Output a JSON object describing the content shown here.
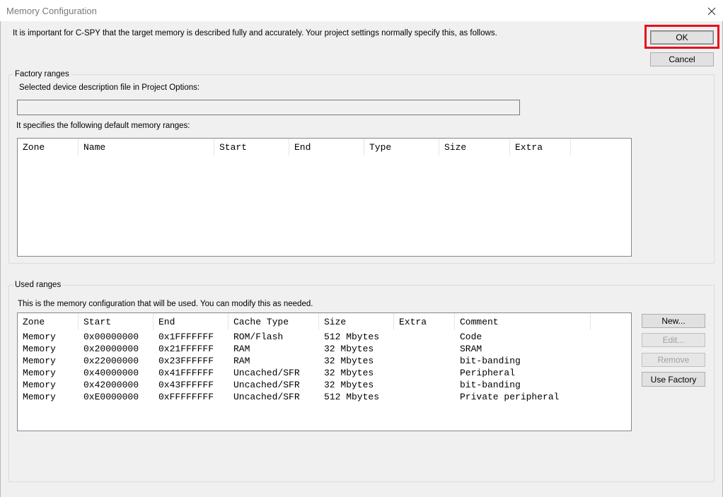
{
  "window": {
    "title": "Memory Configuration",
    "close_icon": "close-icon"
  },
  "intro_text": "It is important for C-SPY that the target memory is described fully and accurately. Your project settings normally specify this, as follows.",
  "buttons": {
    "ok": "OK",
    "cancel": "Cancel",
    "new": "New...",
    "edit": "Edit...",
    "remove": "Remove",
    "use_factory": "Use Factory"
  },
  "highlight_color": "#e8101c",
  "factory": {
    "group_label": "Factory ranges",
    "device_label": "Selected device description file in Project Options:",
    "device_value": "",
    "ranges_label": "It specifies the following default memory ranges:",
    "columns": [
      "Zone",
      "Name",
      "Start",
      "End",
      "Type",
      "Size",
      "Extra"
    ],
    "rows": []
  },
  "used": {
    "group_label": "Used ranges",
    "description": "This is the memory configuration that will be used. You can modify this as needed.",
    "columns": [
      "Zone",
      "Start",
      "End",
      "Cache Type",
      "Size",
      "Extra",
      "Comment"
    ],
    "rows": [
      [
        "Memory",
        "0x00000000",
        "0x1FFFFFFF",
        "ROM/Flash",
        "512 Mbytes",
        "",
        "Code"
      ],
      [
        "Memory",
        "0x20000000",
        "0x21FFFFFF",
        "RAM",
        "32 Mbytes",
        "",
        "SRAM"
      ],
      [
        "Memory",
        "0x22000000",
        "0x23FFFFFF",
        "RAM",
        "32 Mbytes",
        "",
        "bit-banding"
      ],
      [
        "Memory",
        "0x40000000",
        "0x41FFFFFF",
        "Uncached/SFR",
        "32 Mbytes",
        "",
        "Peripheral"
      ],
      [
        "Memory",
        "0x42000000",
        "0x43FFFFFF",
        "Uncached/SFR",
        "32 Mbytes",
        "",
        "bit-banding"
      ],
      [
        "Memory",
        "0xE0000000",
        "0xFFFFFFFF",
        "Uncached/SFR",
        "512 Mbytes",
        "",
        "Private peripheral"
      ]
    ]
  }
}
